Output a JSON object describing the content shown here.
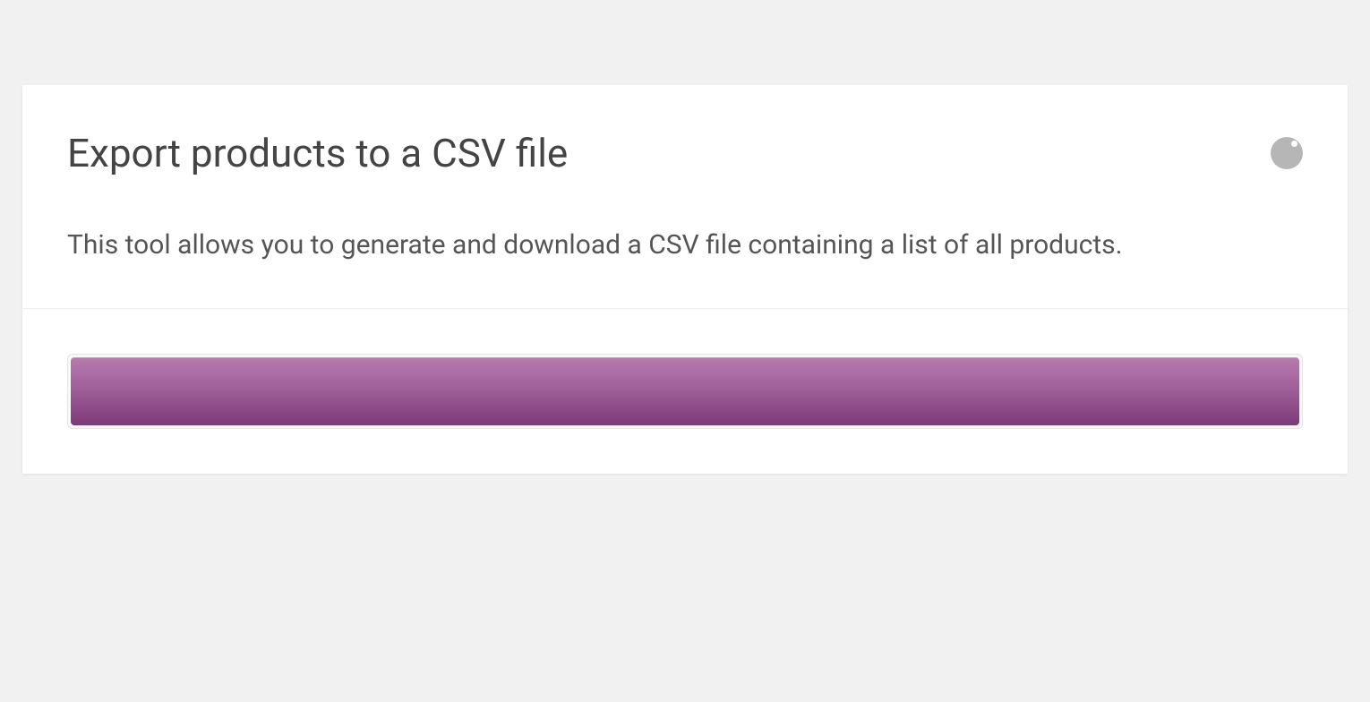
{
  "export": {
    "title": "Export products to a CSV file",
    "description": "This tool allows you to generate and download a CSV file containing a list of all products.",
    "progress_percent": 100
  }
}
